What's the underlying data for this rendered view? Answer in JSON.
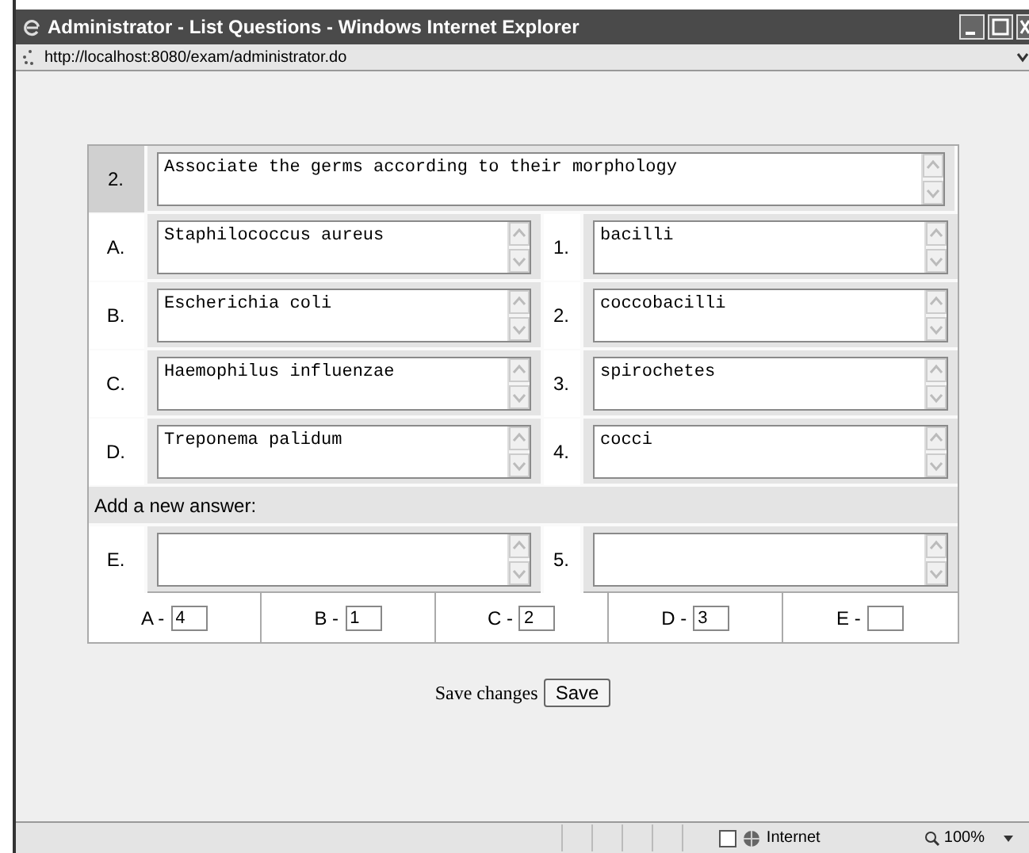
{
  "window": {
    "title": "Administrator - List Questions - Windows Internet Explorer",
    "address": "http://localhost:8080/exam/administrator.do"
  },
  "question": {
    "number": "2.",
    "text": "Associate the germs according to their morphology"
  },
  "answers": [
    {
      "letter": "A.",
      "text": "Staphilococcus aureus",
      "number": "1.",
      "match": "bacilli"
    },
    {
      "letter": "B.",
      "text": "Escherichia coli",
      "number": "2.",
      "match": "coccobacilli"
    },
    {
      "letter": "C.",
      "text": "Haemophilus influenzae",
      "number": "3.",
      "match": "spirochetes"
    },
    {
      "letter": "D.",
      "text": "Treponema palidum",
      "number": "4.",
      "match": "cocci"
    }
  ],
  "new_answer": {
    "label": "Add a new answer:",
    "letter": "E.",
    "number": "5."
  },
  "mapping": [
    {
      "label": "A -",
      "value": "4"
    },
    {
      "label": "B -",
      "value": "1"
    },
    {
      "label": "C -",
      "value": "2"
    },
    {
      "label": "D -",
      "value": "3"
    },
    {
      "label": "E -"
    }
  ],
  "save": {
    "label": "Save changes",
    "button": "Save"
  },
  "status_bar": {
    "zone": "Internet",
    "zoom": "100%"
  }
}
